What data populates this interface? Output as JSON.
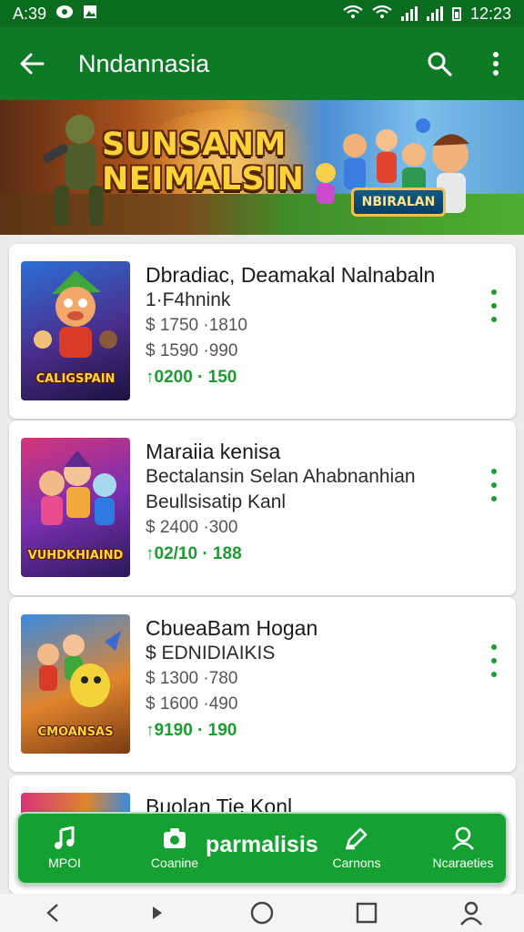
{
  "status_bar": {
    "time_left": "A:39",
    "time_right": "12:23"
  },
  "app_bar": {
    "title": "Nndannasia",
    "icons": [
      "back-arrow-icon",
      "search-icon",
      "more-vert-icon"
    ]
  },
  "banner": {
    "title_line1": "SUNSANM",
    "title_line2": "NEIMALSIN",
    "badge": "NBIRALAN"
  },
  "items": [
    {
      "title": "Dbradiac, Deamakal Nalnabaln",
      "subtitle": "1·F4hnink",
      "price1": "$ 1750 ·1810",
      "price2": "$ 1590 ·990",
      "green": "↑0200 · 150",
      "thumb_label": "CALIGSPAIN"
    },
    {
      "title": "Maraiia kenisa",
      "subtitle": "Bectalansin Selan Ahabnanhian",
      "subtitle2": "Beullsisatip Kanl",
      "price1": "$ 2400 ·300",
      "green": "↑02/10 · 188",
      "thumb_label": "VUHDKHIAIND"
    },
    {
      "title": "CbueaBam Hogan",
      "subtitle": "$ EDNIDIAIKIS",
      "price1": "$ 1300 ·780",
      "price2": "$ 1600 ·490",
      "green": "↑9190 · 190",
      "thumb_label": "CMOANSAS"
    },
    {
      "title": "Buolan Tie Konl"
    }
  ],
  "bottom_nav": {
    "center_label": "parmalisis",
    "items": [
      {
        "label": "MPOI",
        "icon": "music-note-icon"
      },
      {
        "label": "Coanine",
        "icon": "camera-icon"
      },
      {
        "label": "Carnons",
        "icon": "edit-icon"
      },
      {
        "label": "Ncaraeties",
        "icon": "person-icon"
      }
    ]
  },
  "colors": {
    "status_bar": "#0b6b1f",
    "app_bar": "#0f7a25",
    "accent_green": "#1f9a34",
    "nav_green": "#14a132"
  }
}
